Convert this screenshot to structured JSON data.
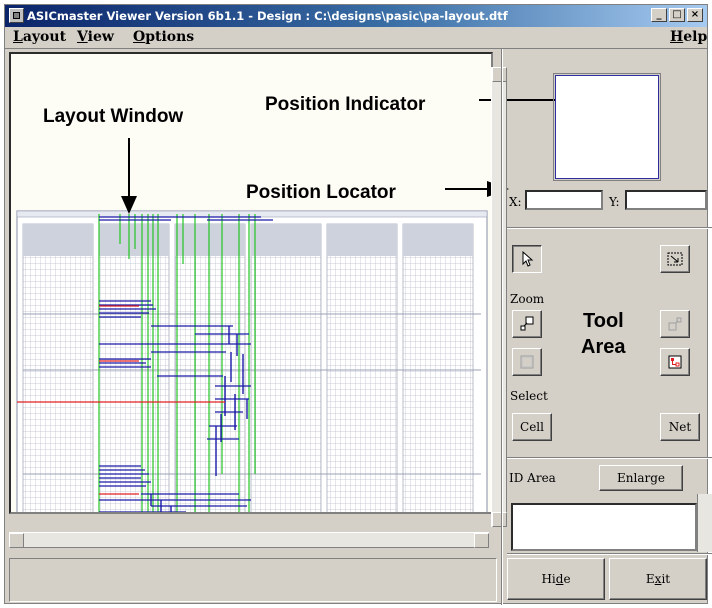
{
  "window": {
    "title": "ASICmaster Viewer  Version 6b1.1 - Design : C:\\designs\\pasic\\pa-layout.dtf",
    "minimize_glyph": "_",
    "maximize_glyph": "□",
    "close_glyph": "×",
    "icon": "app-icon"
  },
  "menubar": {
    "layout": {
      "accel": "L",
      "rest": "ayout"
    },
    "view": {
      "accel": "V",
      "rest": "iew"
    },
    "options": {
      "accel": "O",
      "rest": "ptions"
    },
    "help": {
      "accel": "H",
      "rest": "elp"
    }
  },
  "annotations": {
    "layout_window": "Layout Window",
    "position_indicator": "Position Indicator",
    "position_locator": "Position Locator"
  },
  "locator": {
    "x_label": "X:",
    "y_label": "Y:",
    "x_value": "",
    "y_value": ""
  },
  "tools": {
    "pointer_icon": "pointer-arrow-icon",
    "zoom_box_icon": "zoom-box-icon",
    "zoom_label": "Zoom",
    "zoom_in_icon": "zoom-in-icon",
    "zoom_out_icon": "zoom-out-icon",
    "zoom_fit_icon": "zoom-fit-icon",
    "zoom_select_icon": "zoom-select-icon",
    "tool_area_line1": "Tool",
    "tool_area_line2": "Area",
    "select_label": "Select",
    "cell_button": "Cell",
    "net_button": "Net"
  },
  "id_area": {
    "label": "ID Area",
    "enlarge_button": "Enlarge",
    "text": ""
  },
  "footer": {
    "hide": {
      "pre": "Hi",
      "accel": "d",
      "post": "e"
    },
    "exit": {
      "pre": "E",
      "accel": "x",
      "post": "it"
    }
  },
  "colors": {
    "title_gradient_start": "#0a246a",
    "net_blue": "#1a1aa8",
    "net_green": "#22c422",
    "net_red": "#e02020",
    "row_fill": "#cdd2dc"
  }
}
